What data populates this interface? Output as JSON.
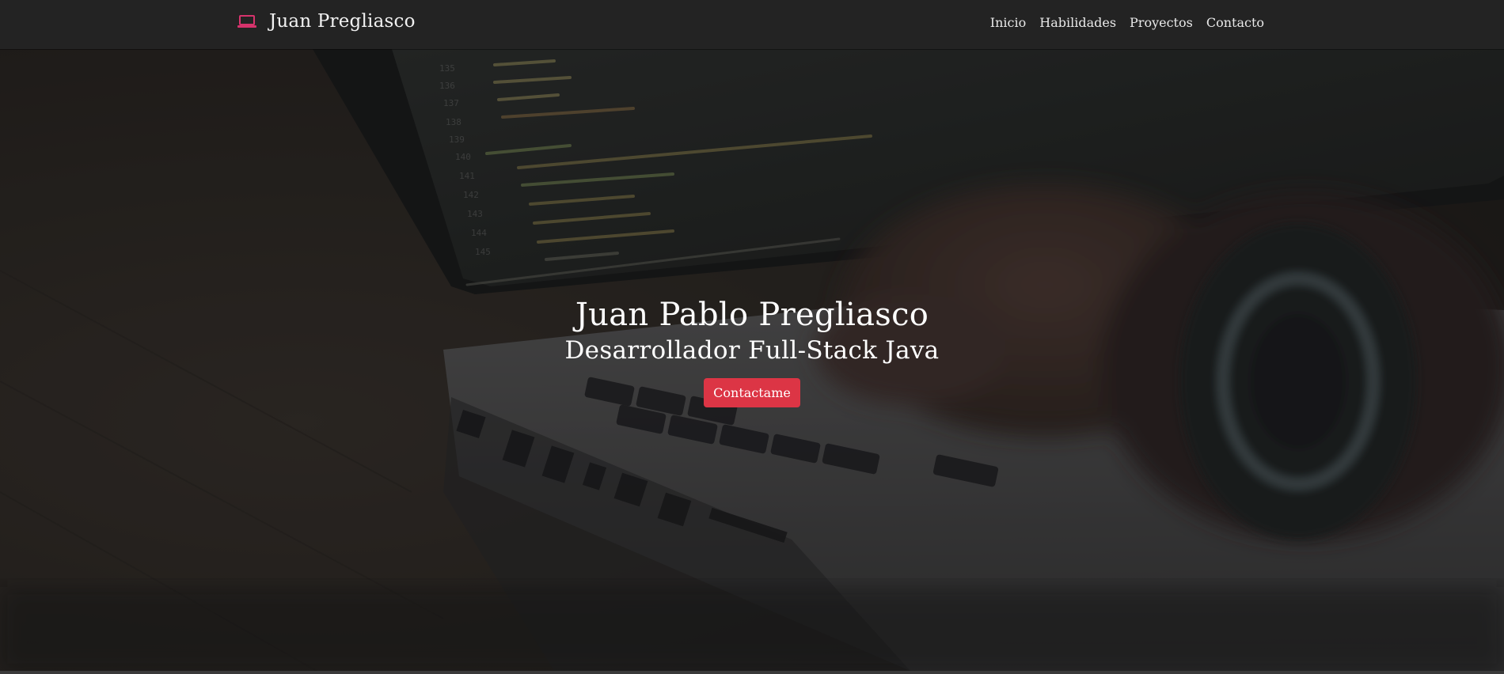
{
  "navbar": {
    "brand_icon": "laptop-icon",
    "brand_name": "Juan Pregliasco",
    "links": [
      {
        "label": "Inicio"
      },
      {
        "label": "Habilidades"
      },
      {
        "label": "Proyectos"
      },
      {
        "label": "Contacto"
      }
    ]
  },
  "hero": {
    "title": "Juan Pablo Pregliasco",
    "subtitle": "Desarrollador Full-Stack Java",
    "cta_label": "Contactame"
  },
  "colors": {
    "navbar_bg": "#232323",
    "accent": "#dc3545",
    "icon_accent": "#d6336c"
  }
}
